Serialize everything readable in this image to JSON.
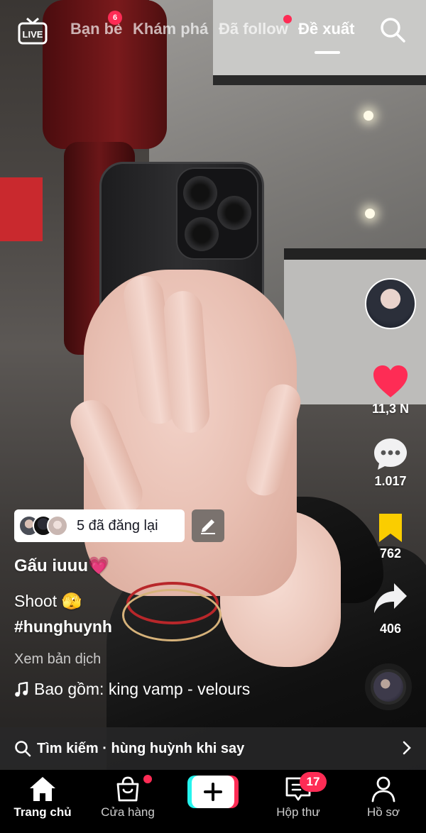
{
  "top_nav": {
    "tabs": [
      {
        "label": "Bạn bè",
        "badge": "6"
      },
      {
        "label": "Khám phá"
      },
      {
        "label": "Đã follow",
        "dot": true
      },
      {
        "label": "Đề xuất",
        "active": true
      }
    ],
    "live_icon": "live-tv-icon",
    "search_icon": "search-icon"
  },
  "rail": {
    "like_count": "11,3 N",
    "comment_count": "1.017",
    "save_count": "762",
    "share_count": "406"
  },
  "caption": {
    "repost_text": "5 đã đăng lại",
    "author": "Gấu iuuu💗",
    "description": "Shoot 🫣",
    "hashtag": "#hunghuynh",
    "translate": "Xem bản dịch",
    "music": "Bao gồm: king vamp - velours"
  },
  "search_suggestion": {
    "text": "Tìm kiếm · hùng huỳnh khi say"
  },
  "bottom_nav": {
    "items": [
      {
        "label": "Trang chủ",
        "icon": "home-icon",
        "active": true
      },
      {
        "label": "Cửa hàng",
        "icon": "shop-bag-icon",
        "dot": true
      },
      {
        "label": "",
        "icon": "create-plus-icon"
      },
      {
        "label": "Hộp thư",
        "icon": "inbox-icon",
        "badge": "17"
      },
      {
        "label": "Hồ sơ",
        "icon": "profile-icon"
      }
    ]
  },
  "colors": {
    "accent": "#fe2c55",
    "cyan": "#25f4ee",
    "bookmark": "#facd00"
  }
}
